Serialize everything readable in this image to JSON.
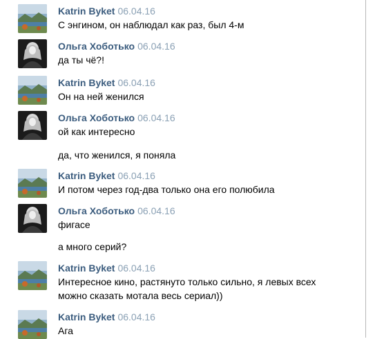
{
  "users": {
    "katrin": "Katrin Byket",
    "olga": "Ольга Хоботько"
  },
  "messages": [
    {
      "author": "Katrin Byket",
      "date": "06.04.16",
      "lines": [
        "С энгином, он наблюдал как раз, был 4-м"
      ]
    },
    {
      "author": "Ольга Хоботько",
      "date": "06.04.16",
      "lines": [
        "да ты чё?!"
      ]
    },
    {
      "author": "Katrin Byket",
      "date": "06.04.16",
      "lines": [
        "Он на ней женился"
      ]
    },
    {
      "author": "Ольга Хоботько",
      "date": "06.04.16",
      "lines": [
        "ой как интересно",
        "да, что женился, я поняла"
      ]
    },
    {
      "author": "Katrin Byket",
      "date": "06.04.16",
      "lines": [
        "И потом через год-два только она его полюбила"
      ]
    },
    {
      "author": "Ольга Хоботько",
      "date": "06.04.16",
      "lines": [
        "фигасе",
        "а много серий?"
      ]
    },
    {
      "author": "Katrin Byket",
      "date": "06.04.16",
      "lines": [
        "Интересное кино, растянуто только сильно, я левых всех",
        "можно сказать мотала весь сериал))"
      ]
    },
    {
      "author": "Katrin Byket",
      "date": "06.04.16",
      "lines": [
        "Ага"
      ]
    }
  ],
  "colors": {
    "name": "#3b5c7e",
    "date": "#8aa0b4",
    "text": "#000000"
  },
  "icons": {
    "katrin_avatar": "landscape-avatar-icon",
    "olga_avatar": "portrait-avatar-icon"
  }
}
